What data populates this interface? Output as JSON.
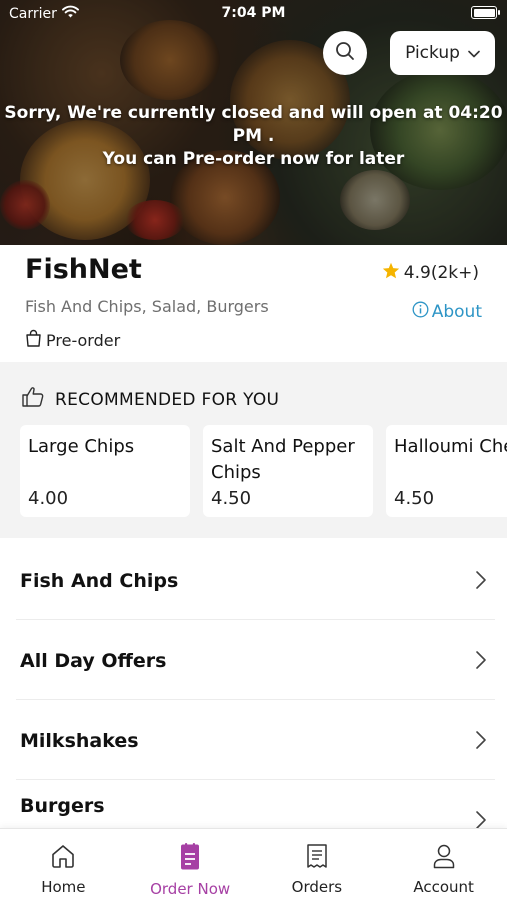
{
  "status_bar": {
    "carrier": "Carrier",
    "time": "7:04 PM"
  },
  "header": {
    "pickup_label": "Pickup"
  },
  "closed_message": {
    "line1": "Sorry, We're currently closed and will open at 04:20 PM .",
    "line2": "You can Pre-order now for later"
  },
  "restaurant": {
    "name": "FishNet",
    "rating": "4.9(2k+)",
    "cuisine": "Fish And Chips, Salad, Burgers",
    "about_label": "About",
    "preorder_label": "Pre-order"
  },
  "recommended": {
    "title": "RECOMMENDED FOR YOU",
    "items": [
      {
        "name": "Large Chips",
        "price": "4.00"
      },
      {
        "name": "Salt And Pepper Chips",
        "price": "4.50"
      },
      {
        "name": "Halloumi Cheese Fries",
        "price": "4.50"
      }
    ]
  },
  "categories": [
    "Fish And Chips",
    "All Day Offers",
    "Milkshakes",
    "Burgers"
  ],
  "tabs": [
    {
      "label": "Home",
      "icon": "home-icon",
      "active": false
    },
    {
      "label": "Order Now",
      "icon": "order-icon",
      "active": true
    },
    {
      "label": "Orders",
      "icon": "receipt-icon",
      "active": false
    },
    {
      "label": "Account",
      "icon": "user-icon",
      "active": false
    }
  ],
  "colors": {
    "accent": "#a640a4",
    "link": "#2e95c6",
    "star": "#f5b400"
  }
}
